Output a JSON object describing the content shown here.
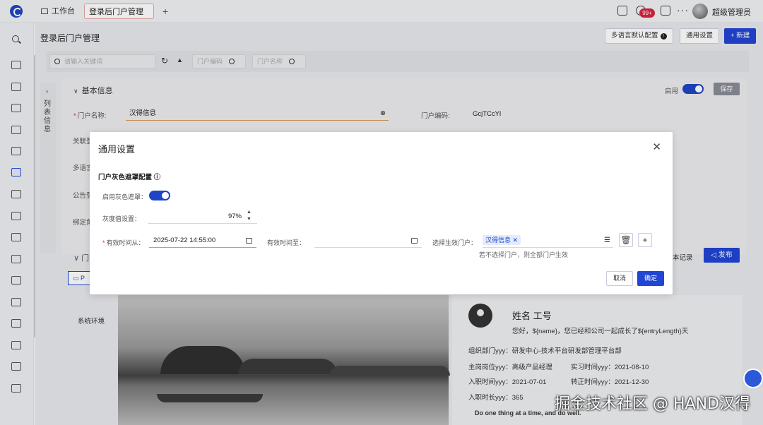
{
  "topbar": {
    "workbench": "工作台",
    "active_tab": "登录后门户管理",
    "notification_badge": "99+",
    "username": "超级管理员"
  },
  "page": {
    "title": "登录后门户管理",
    "btn_lang": "多语言默认配置",
    "btn_general": "通用设置",
    "btn_new": "新建"
  },
  "search": {
    "placeholder": "请输入关键词",
    "code_placeholder": "门户编码",
    "name_placeholder": "门户名称"
  },
  "side_panel": {
    "label": "列表信息"
  },
  "form": {
    "section": "基本信息",
    "enable_label": "启用",
    "save": "保存",
    "name_label": "门户名称:",
    "name_value": "汉得信息",
    "code_label": "门户编码:",
    "code_value": "GcjTCcYl",
    "row3": "关联登",
    "row4": "多语言",
    "row5": "公告登",
    "row6": "绑定角",
    "publish": "发布",
    "records": "本记录",
    "env_label": "系统环境"
  },
  "profile": {
    "name": "姓名 工号",
    "greeting": "您好，${name}，您已经和公司一起成长了${entryLength}天",
    "dept": "组织部门yyy：研发中心-技术平台研发部管理平台部",
    "post": "主岗岗位yyy：高级产品经理",
    "intern": "实习时间yyy：2021-08-10",
    "entry": "入职时间yyy：2021-07-01",
    "regular": "转正时间yyy：2021-12-30",
    "entry_len": "入职时长yyy：365",
    "motto": "Do one thing at a time, and do well."
  },
  "modal": {
    "title": "通用设置",
    "section": "门户灰色遮罩配置",
    "gray_label": "启用灰色遮罩：",
    "gray_enabled": true,
    "gray_value_label": "灰度值设置：",
    "gray_value": "97%",
    "from_label": "有效时间从：",
    "from_value": "2025-07-22 14:55:00",
    "to_label": "有效时间至：",
    "to_value": "",
    "portal_label": "选择生效门户：",
    "portal_tag": "汉得信息",
    "hint": "若不选择门户，则全部门户生效",
    "cancel": "取消",
    "confirm": "确定"
  },
  "watermark": "掘金技术社区 @ HAND汉得",
  "colors": {
    "primary": "#2145d4",
    "danger": "#d8233f"
  }
}
